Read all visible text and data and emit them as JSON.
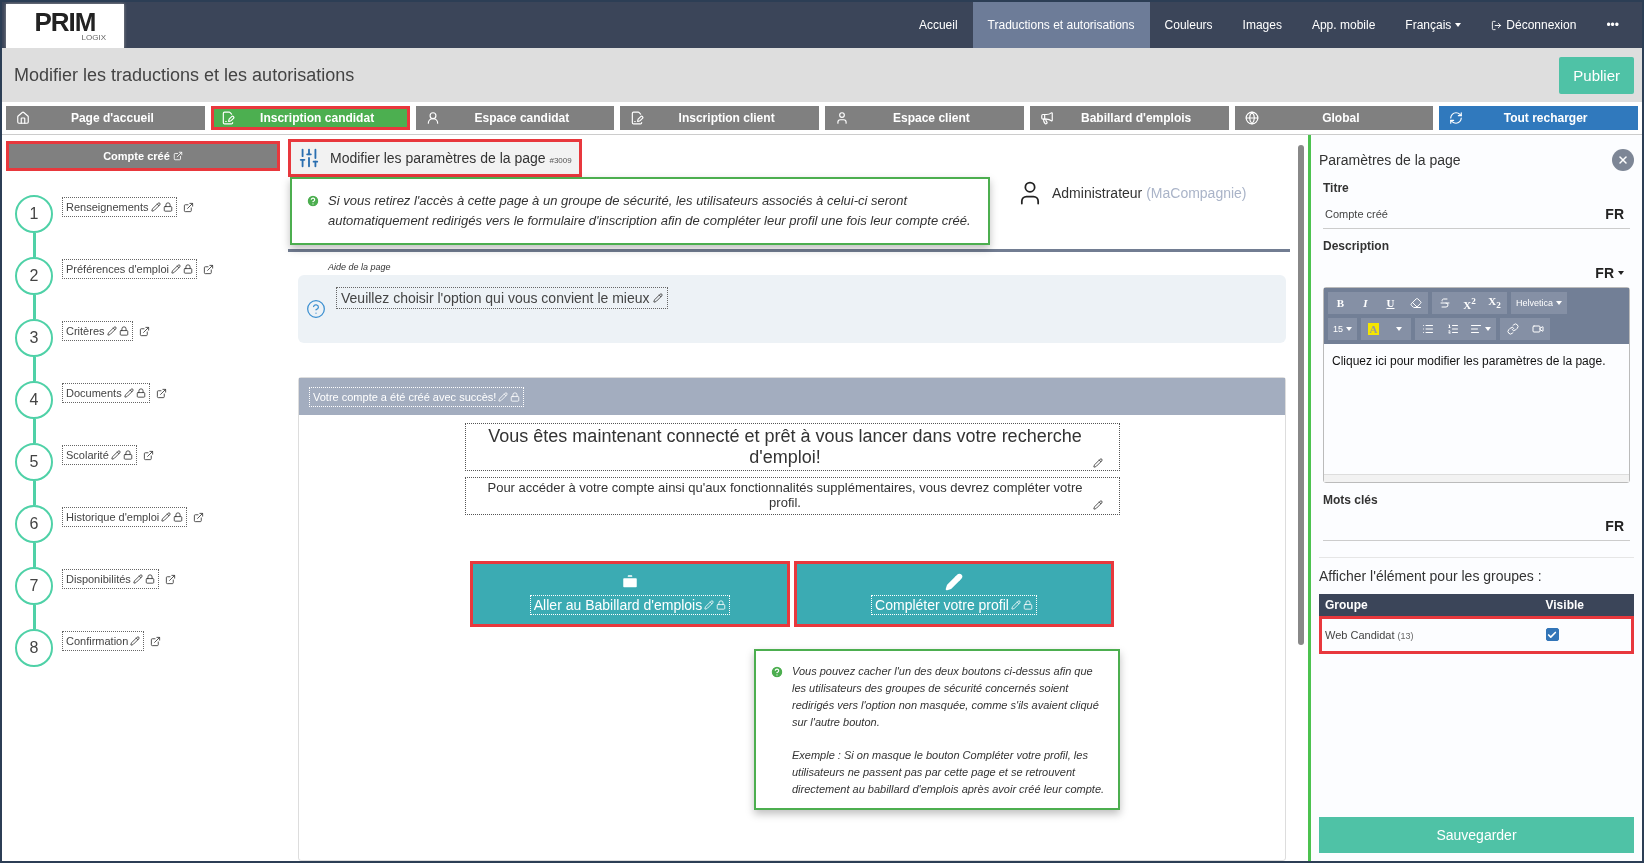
{
  "nav": {
    "logo": "PRIM",
    "logo_sub": "LOGIX",
    "items": [
      {
        "label": "Accueil",
        "kind": "link",
        "selected": false
      },
      {
        "label": "Traductions et autorisations",
        "kind": "link",
        "selected": true
      },
      {
        "label": "Couleurs",
        "kind": "link",
        "selected": false
      },
      {
        "label": "Images",
        "kind": "link",
        "selected": false
      },
      {
        "label": "App. mobile",
        "kind": "link",
        "selected": false
      },
      {
        "label": "Français",
        "kind": "dropdown",
        "selected": false
      },
      {
        "label": "Déconnexion",
        "kind": "logout",
        "selected": false
      },
      {
        "label": "•••",
        "kind": "more",
        "selected": false
      }
    ]
  },
  "title": "Modifier les traductions et les autorisations",
  "publish_button": "Publier",
  "page_tabs": [
    {
      "label": "Page d'accueil",
      "kind": "home",
      "selected": false,
      "highlighted": false
    },
    {
      "label": "Inscription candidat",
      "kind": "edit",
      "selected": true,
      "highlighted": true
    },
    {
      "label": "Espace candidat",
      "kind": "user",
      "selected": false,
      "highlighted": false
    },
    {
      "label": "Inscription client",
      "kind": "edit",
      "selected": false,
      "highlighted": false
    },
    {
      "label": "Espace client",
      "kind": "client",
      "selected": false,
      "highlighted": false
    },
    {
      "label": "Babillard d'emplois",
      "kind": "megaphone",
      "selected": false,
      "highlighted": false
    },
    {
      "label": "Global",
      "kind": "globe",
      "selected": false,
      "highlighted": false
    },
    {
      "label": "Tout recharger",
      "kind": "reload",
      "selected": false,
      "highlighted": false
    }
  ],
  "section_header": {
    "label": "Compte créé",
    "highlighted": true
  },
  "steps": [
    {
      "number": "1",
      "label": "Renseignements",
      "locked": true
    },
    {
      "number": "2",
      "label": "Préférences d'emploi",
      "locked": true
    },
    {
      "number": "3",
      "label": "Critères",
      "locked": true
    },
    {
      "number": "4",
      "label": "Documents",
      "locked": true
    },
    {
      "number": "5",
      "label": "Scolarité",
      "locked": true
    },
    {
      "number": "6",
      "label": "Historique d'emploi",
      "locked": true
    },
    {
      "number": "7",
      "label": "Disponibilités",
      "locked": true
    },
    {
      "number": "8",
      "label": "Confirmation",
      "locked": false
    }
  ],
  "page_header": {
    "title": "Modifier les paramètres de la page",
    "code": "#3009",
    "highlighted": true
  },
  "info_tip": "Si vous retirez l'accès à cette page à un groupe de sécurité, les utilisateurs associés à celui-ci seront automatiquement redirigés vers le formulaire d'inscription afin de compléter leur profil une fois leur compte créé.",
  "user": {
    "name": "Administrateur",
    "company": "(MaCompagnie)"
  },
  "page_help": {
    "label": "Aide de la page",
    "text": "Veuillez choisir l'option qui vous convient le mieux"
  },
  "panel": {
    "title": "Votre compte a été créé avec succès!",
    "heading": "Vous êtes maintenant connecté et prêt à vous lancer dans votre recherche d'emploi!",
    "subtext": "Pour accéder à votre compte ainsi qu'aux fonctionnalités supplémentaires, vous devrez compléter votre profil.",
    "buttons": [
      {
        "label": "Aller au Babillard d'emplois",
        "kind": "briefcase",
        "highlighted": true
      },
      {
        "label": "Compléter votre profil",
        "kind": "pencil",
        "highlighted": true
      }
    ],
    "tip": [
      "Vous pouvez cacher l'un des deux boutons ci-dessus afin que les utilisateurs des groupes de sécurité concernés soient redirigés vers l'option non masquée, comme s'ils avaient cliqué sur l'autre bouton.",
      "Exemple : Si on masque le bouton Compléter votre profil, les utilisateurs ne passent pas par cette page et se retrouvent directement au babillard d'emplois après avoir créé leur compte."
    ]
  },
  "settings": {
    "title": "Paramètres de la page",
    "title_label": "Titre",
    "title_value": "Compte créé",
    "title_lang": "FR",
    "description_label": "Description",
    "description_lang": "FR",
    "toolbar": [
      [
        [
          {
            "kind": "bold",
            "label": "B"
          },
          {
            "kind": "italic",
            "label": "I"
          },
          {
            "kind": "underline",
            "label": "U"
          },
          {
            "kind": "eraser"
          }
        ],
        [
          {
            "kind": "strike"
          },
          {
            "kind": "text",
            "label": "X$^{2}$"
          },
          {
            "kind": "text",
            "label": "X$_{2}$"
          }
        ],
        [
          {
            "kind": "dropdown",
            "label": "Helvetica"
          }
        ]
      ],
      [
        [
          {
            "kind": "dropdown",
            "label": "15"
          }
        ],
        [
          {
            "kind": "color",
            "label": "A"
          },
          {
            "kind": "caret"
          }
        ],
        [
          {
            "kind": "ul"
          },
          {
            "kind": "ol"
          },
          {
            "kind": "align"
          }
        ],
        [
          {
            "kind": "link"
          },
          {
            "kind": "video"
          }
        ]
      ]
    ],
    "editor_text": "Cliquez ici pour modifier les paramètres de la page.",
    "keywords_label": "Mots clés",
    "keywords_lang": "FR",
    "groups_label": "Afficher l'élément pour les groupes :",
    "columns": [
      "Groupe",
      "Visible"
    ],
    "groups": [
      {
        "name": "Web Candidat",
        "count": "(13)",
        "visible": true,
        "highlighted": true
      }
    ],
    "save_button": "Sauvegarder"
  }
}
